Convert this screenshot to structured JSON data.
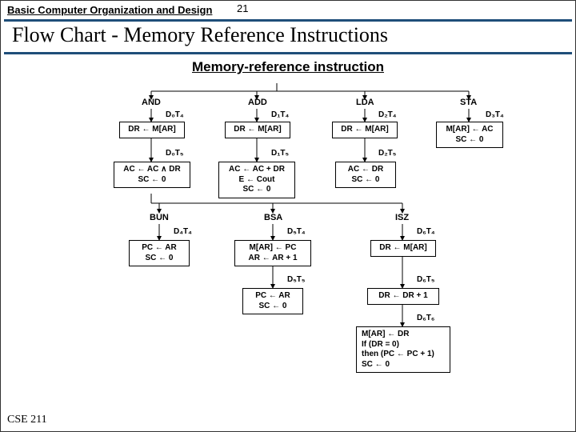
{
  "header": {
    "course": "Basic Computer Organization and Design",
    "page_no": "21"
  },
  "title": "Flow Chart - Memory Reference Instructions",
  "subtitle": "Memory-reference instruction",
  "op": {
    "and": "AND",
    "add": "ADD",
    "lda": "LDA",
    "sta": "STA",
    "bun": "BUN",
    "bsa": "BSA",
    "isz": "ISZ"
  },
  "tag": {
    "d0t4": "D₀T₄",
    "d1t4": "D₁T₄",
    "d2t4": "D₂T₄",
    "d3t4": "D₃T₄",
    "d0t5": "D₀T₅",
    "d1t5": "D₁T₅",
    "d2t5": "D₂T₅",
    "d4t4": "D₄T₄",
    "d5t4": "D₅T₄",
    "d6t4": "D₆T₄",
    "d5t5": "D₅T₅",
    "d6t5": "D₆T₅",
    "d6t6": "D₆T₆"
  },
  "box": {
    "dr_mar_1": "DR ← M[AR]",
    "dr_mar_2": "DR ← M[AR]",
    "dr_mar_3": "DR ← M[AR]",
    "sta": "M[AR] ← AC\nSC ← 0",
    "and": "AC ← AC ∧ DR\nSC ← 0",
    "add": "AC ← AC + DR\nE ← Cout\nSC ← 0",
    "lda": "AC ← DR\nSC ← 0",
    "bun": "PC ← AR\nSC ← 0",
    "bsa1": "M[AR] ← PC\nAR ← AR + 1",
    "bsa2": "PC ← AR\nSC ← 0",
    "isz1": "DR ← M[AR]",
    "isz2": "DR ← DR + 1",
    "isz3": "M[AR] ← DR\nIf (DR = 0)\nthen (PC ← PC + 1)\nSC ← 0"
  },
  "footer": "CSE 211"
}
